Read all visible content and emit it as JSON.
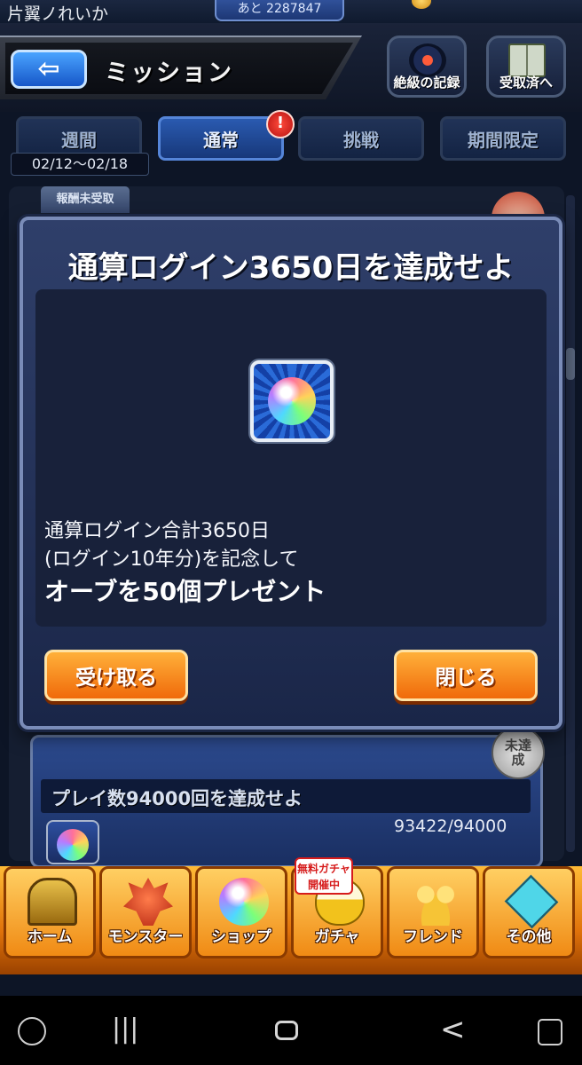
{
  "status": {
    "player_name": "片翼ノれいか",
    "counter_text": "あと 2287847"
  },
  "header": {
    "title": "ミッション",
    "record_button": "絶級の記録",
    "received_button": "受取済へ"
  },
  "tabs": [
    {
      "label": "週間"
    },
    {
      "label": "通常",
      "alert": "!"
    },
    {
      "label": "挑戦"
    },
    {
      "label": "期間限定"
    }
  ],
  "week_range": "02/12～02/18",
  "list": {
    "unclaimed_tag": "報酬未受取",
    "next_mission": {
      "title": "プレイ数94000回を達成せよ",
      "progress": "93422/94000",
      "status_badge": "未達成"
    }
  },
  "modal": {
    "title": "通算ログイン3650日を達成せよ",
    "reward_line_1": "通算ログイン合計3650日",
    "reward_line_2": "(ログイン10年分)を記念して",
    "reward_line_3": "オーブを50個プレゼント",
    "receive_button": "受け取る",
    "close_button": "閉じる"
  },
  "bottom_nav": {
    "items": [
      {
        "label": "ホーム",
        "icon": "home-icon"
      },
      {
        "label": "モンスター",
        "icon": "monster-icon"
      },
      {
        "label": "ショップ",
        "icon": "orb-icon"
      },
      {
        "label": "ガチャ",
        "icon": "egg-icon"
      },
      {
        "label": "フレンド",
        "icon": "friend-icon"
      },
      {
        "label": "その他",
        "icon": "diamond-icon"
      }
    ],
    "gacha_badge": "無料ガチャ開催中"
  },
  "system_nav": {
    "recents": "|||",
    "back": "<"
  }
}
